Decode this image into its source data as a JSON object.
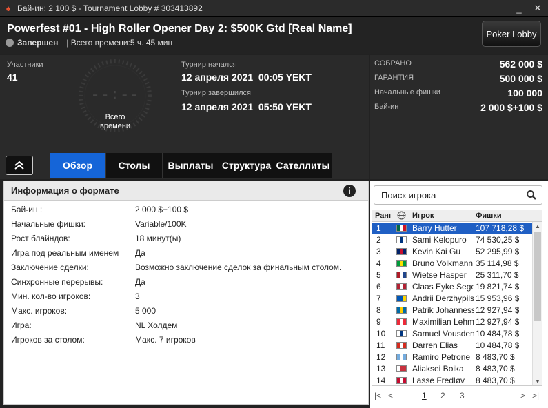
{
  "titlebar": {
    "title": "Бай-ин: 2 100 $ - Tournament Lobby # 303413892",
    "minimize": "_",
    "close": "✕"
  },
  "header": {
    "name": "Powerfest #01 - High Roller Opener Day 2: $500K Gtd [Real Name]",
    "status": "Завершен",
    "total_time": "| Всего времени:5 ч. 45 мин",
    "lobby_button": "Poker Lobby"
  },
  "info": {
    "participants_label": "Участники",
    "participants": "41",
    "clock_digits": "--:--",
    "clock_caption": "Всего\nвремени",
    "started_label": "Турнир начался",
    "started": "12 апреля 2021  00:05 YEKT",
    "finished_label": "Турнир завершился",
    "finished": "12 апреля 2021  05:50 YEKT"
  },
  "stats": [
    {
      "label": "СОБРАНО",
      "value": "562 000 $"
    },
    {
      "label": "ГАРАНТИЯ",
      "value": "500 000 $"
    },
    {
      "label": "Начальные фишки",
      "value": "100 000"
    },
    {
      "label": "Бай-ин",
      "value": "2 000 $+100 $"
    }
  ],
  "tabs": [
    "Обзор",
    "Столы",
    "Выплаты",
    "Структура",
    "Сателлиты"
  ],
  "format": {
    "title": "Информация о формате",
    "rows": [
      {
        "k": "Бай-ин :",
        "v": "2 000 $+100 $"
      },
      {
        "k": "Начальные фишки:",
        "v": "Variable/100K"
      },
      {
        "k": "Рост блайндов:",
        "v": "18 минут(ы)"
      },
      {
        "k": "Игра под реальным именем",
        "v": "Да"
      },
      {
        "k": "Заключение сделки:",
        "v": "Возможно заключение сделок за финальным столом."
      },
      {
        "k": "Синхронные перерывы:",
        "v": "Да"
      },
      {
        "k": "Мин. кол-во игроков:",
        "v": "3"
      },
      {
        "k": "Макс. игроков:",
        "v": "5 000"
      },
      {
        "k": "Игра:",
        "v": "NL Холдем"
      },
      {
        "k": "Игроков за столом:",
        "v": "Макс. 7 игроков"
      }
    ]
  },
  "players": {
    "search_placeholder": "Поиск игрока",
    "headers": {
      "rank": "Ранг",
      "player": "Игрок",
      "chips": "Фишки"
    },
    "rows": [
      {
        "rank": "1",
        "name": "Barry Hutter",
        "chips": "107 718,28 $",
        "flag": [
          "#006847",
          "#fff",
          "#ce1126"
        ]
      },
      {
        "rank": "2",
        "name": "Sami Kelopuro",
        "chips": "74 530,25 $",
        "flag": [
          "#fff",
          "#003580",
          "#fff"
        ]
      },
      {
        "rank": "3",
        "name": "Kevin Kai Gu",
        "chips": "52 295,99 $",
        "flag": [
          "#012169",
          "#c8102e",
          "#012169"
        ]
      },
      {
        "rank": "4",
        "name": "Bruno Volkmann",
        "chips": "35 114,98 $",
        "flag": [
          "#009b3a",
          "#fedf00",
          "#009b3a"
        ]
      },
      {
        "rank": "5",
        "name": "Wietse Hasper",
        "chips": "25 311,70 $",
        "flag": [
          "#ae1c28",
          "#fff",
          "#21468b"
        ]
      },
      {
        "rank": "6",
        "name": "Claas Eyke Segebrecht",
        "chips": "19 821,74 $",
        "flag": [
          "#b22234",
          "#fff",
          "#b22234"
        ]
      },
      {
        "rank": "7",
        "name": "Andrii Derzhypilskyi",
        "chips": "15 953,96 $",
        "flag": [
          "#0057b7",
          "#0057b7",
          "#ffd700"
        ]
      },
      {
        "rank": "8",
        "name": "Patrik Johannesson",
        "chips": "12 927,94 $",
        "flag": [
          "#006aa7",
          "#fecc00",
          "#006aa7"
        ]
      },
      {
        "rank": "9",
        "name": "Maximilian Lehmanski",
        "chips": "12 927,94 $",
        "flag": [
          "#ed2939",
          "#fff",
          "#ed2939"
        ]
      },
      {
        "rank": "10",
        "name": "Samuel Vousden",
        "chips": "10 484,78 $",
        "flag": [
          "#fff",
          "#003580",
          "#fff"
        ]
      },
      {
        "rank": "11",
        "name": "Darren Elias",
        "chips": "10 484,78 $",
        "flag": [
          "#d52b1e",
          "#fff",
          "#d52b1e"
        ]
      },
      {
        "rank": "12",
        "name": "Ramiro Petrone",
        "chips": "8 483,70 $",
        "flag": [
          "#74acdf",
          "#fff",
          "#74acdf"
        ]
      },
      {
        "rank": "13",
        "name": "Aliaksei Boika",
        "chips": "8 483,70 $",
        "flag": [
          "#fff",
          "#c8313e",
          "#c8313e"
        ]
      },
      {
        "rank": "14",
        "name": "Lasse Fredløv",
        "chips": "8 483,70 $",
        "flag": [
          "#c60c30",
          "#fff",
          "#c60c30"
        ]
      }
    ],
    "pages": [
      "1",
      "2",
      "3"
    ]
  }
}
